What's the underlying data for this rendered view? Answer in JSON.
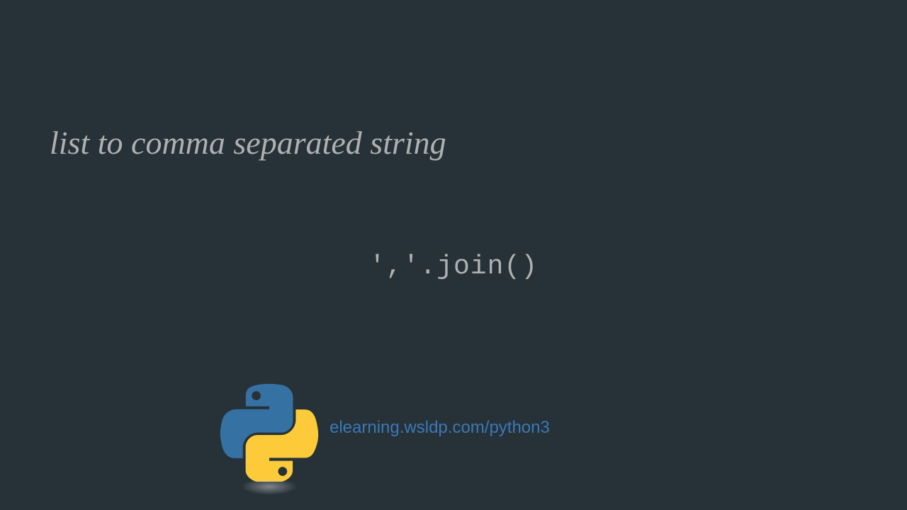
{
  "title": "list to comma separated string",
  "code": "','.join()",
  "url": "elearning.wsldp.com/python3",
  "logo_alt": "python-logo"
}
